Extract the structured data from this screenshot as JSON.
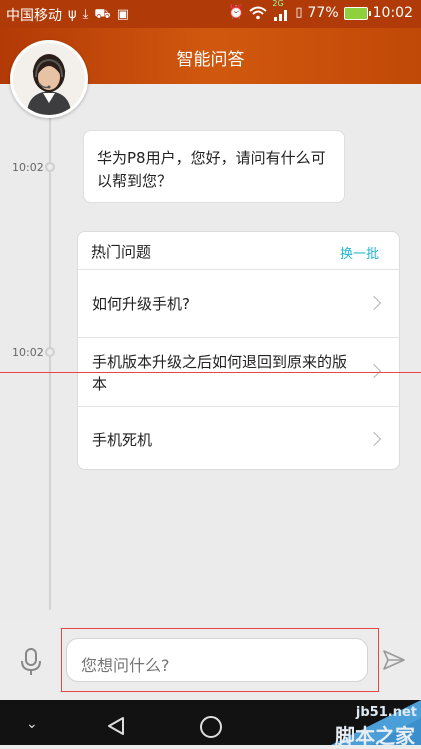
{
  "status_bar": {
    "carrier": "中国移动",
    "network": "2G",
    "battery": "77%",
    "time": "10:02"
  },
  "header": {
    "title": "智能问答"
  },
  "conversation": [
    {
      "time": "10:02",
      "text": "华为P8用户，您好，请问有什么可以帮到您？"
    },
    {
      "time": "10:02"
    }
  ],
  "hot_questions": {
    "title": "热门问题",
    "refresh_label": "换一批",
    "items": [
      {
        "label": "如何升级手机?"
      },
      {
        "label": "手机版本升级之后如何退回到原来的版本"
      },
      {
        "label": "手机死机"
      }
    ]
  },
  "input": {
    "placeholder": "您想问什么?"
  },
  "icons": {
    "mic": "microphone-icon",
    "send": "send-icon",
    "back": "back-icon",
    "home": "home-icon",
    "notifications": "chevron-down-icon"
  },
  "watermark": {
    "site": "jb51.net",
    "name": "脚本之家"
  },
  "colors": {
    "header": "#c14907",
    "accent": "#20b7c9",
    "annotation": "#e64646"
  }
}
